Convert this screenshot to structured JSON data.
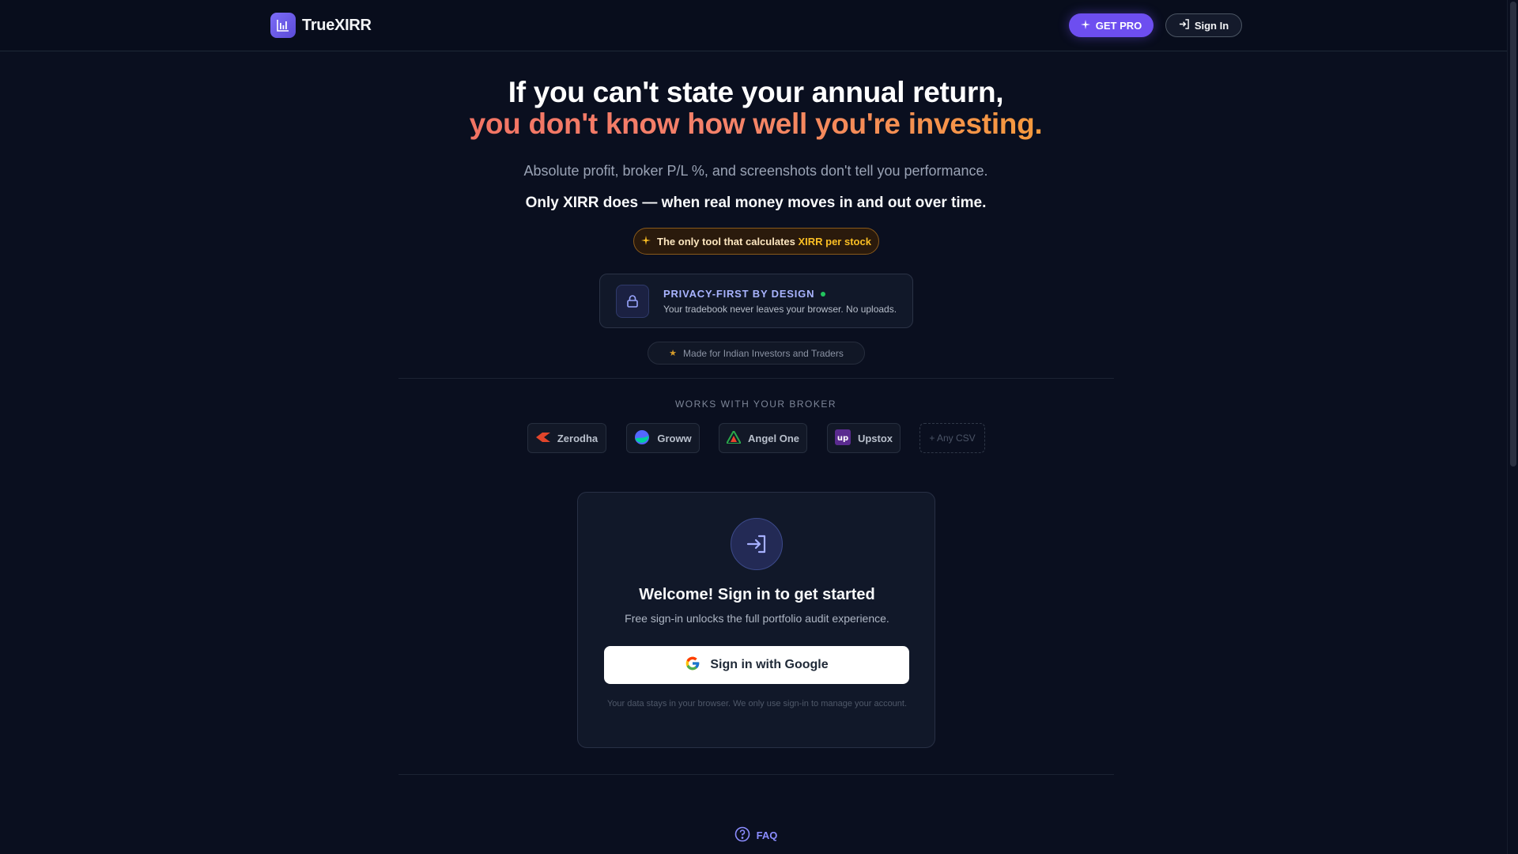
{
  "header": {
    "brand": "TrueXIRR",
    "get_pro": "GET PRO",
    "sign_in": "Sign In"
  },
  "hero": {
    "line1": "If you can't state your annual return,",
    "line2": "you don't know how well you're investing.",
    "subtitle": "Absolute profit, broker P/L %, and screenshots don't tell you performance.",
    "subtitle2": "Only XIRR does — when real money moves in and out over time."
  },
  "badge": {
    "prefix": "The only tool that calculates ",
    "highlight": "XIRR per stock"
  },
  "privacy": {
    "title": "PRIVACY-FIRST BY DESIGN",
    "desc": "Your tradebook never leaves your browser. No uploads."
  },
  "made_for": "Made for Indian Investors and Traders",
  "brokers": {
    "label": "WORKS WITH YOUR BROKER",
    "items": [
      "Zerodha",
      "Groww",
      "Angel One",
      "Upstox",
      "+ Any CSV"
    ]
  },
  "signin_card": {
    "title": "Welcome! Sign in to get started",
    "subtitle": "Free sign-in unlocks the full portfolio audit experience.",
    "google_button": "Sign in with Google",
    "note": "Your data stays in your browser. We only use sign-in to manage your account."
  },
  "faq": "FAQ",
  "colors": {
    "background": "#0a0f1f",
    "accent": "#6d4ef0",
    "gradient_start": "#f27464",
    "gradient_end": "#f59a3d",
    "highlight": "#fbbf24",
    "privacy_title": "#a9b4ff"
  },
  "icons": {
    "brand": "bar-chart-icon",
    "get_pro": "sparkle-icon",
    "sign_in": "sign-in-icon",
    "privacy": "lock-icon",
    "made_for": "star-icon",
    "card": "sign-in-icon",
    "google": "google-icon",
    "faq": "help-circle-icon"
  }
}
